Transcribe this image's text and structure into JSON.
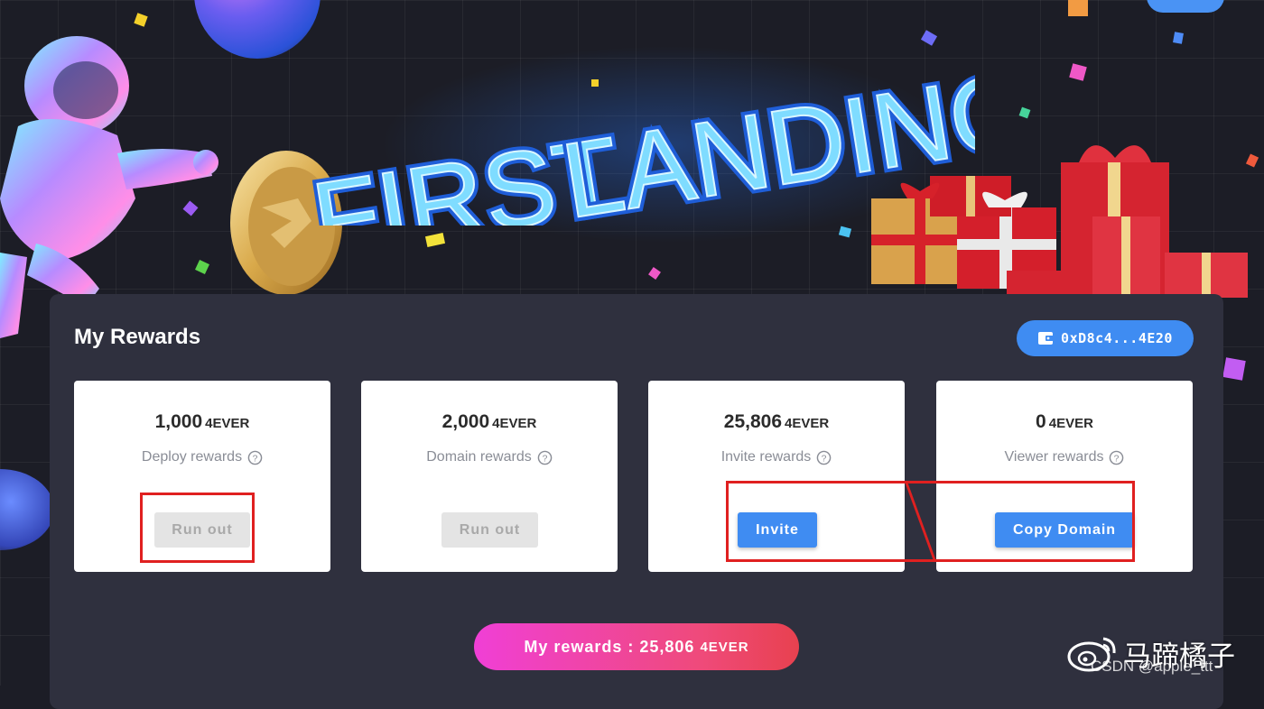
{
  "banner": {
    "title_part1": "FIRST",
    "title_part2": "LANDING",
    "top_button_label": "",
    "colors": {
      "title_fill": "#7fdcff",
      "title_outline": "#1f5ed8",
      "background": "#1c1d26"
    }
  },
  "rewards_panel": {
    "title": "My Rewards",
    "wallet_address": "0xD8c4...4E20",
    "wallet_icon": "wallet-icon",
    "cards": [
      {
        "amount": "1,000",
        "unit": "4EVER",
        "label": "Deploy rewards",
        "help_icon": "help-circle-icon",
        "button_label": "Run out",
        "button_state": "disabled"
      },
      {
        "amount": "2,000",
        "unit": "4EVER",
        "label": "Domain rewards",
        "help_icon": "help-circle-icon",
        "button_label": "Run out",
        "button_state": "disabled"
      },
      {
        "amount": "25,806",
        "unit": "4EVER",
        "label": "Invite rewards",
        "help_icon": "help-circle-icon",
        "button_label": "Invite",
        "button_state": "enabled"
      },
      {
        "amount": "0",
        "unit": "4EVER",
        "label": "Viewer rewards",
        "help_icon": "help-circle-icon",
        "button_label": "Copy Domain",
        "button_state": "enabled"
      }
    ],
    "total": {
      "label": "My rewards :",
      "amount": "25,806",
      "unit": "4EVER"
    },
    "colors": {
      "primary": "#3f8cf2",
      "panel": "#2f303e",
      "highlight": "#e02020",
      "pill_start": "#f03fd6",
      "pill_end": "#e8414f"
    }
  },
  "watermark": {
    "name": "马蹄橘子",
    "source": "CSDN @apple_ttt"
  }
}
